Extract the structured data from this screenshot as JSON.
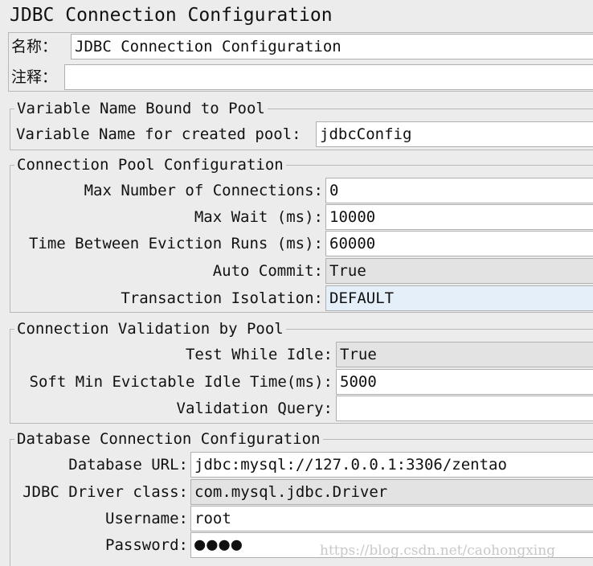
{
  "title": "JDBC Connection Configuration",
  "name_row": {
    "label": "名称：",
    "value": "JDBC Connection Configuration"
  },
  "comment_row": {
    "label": "注释：",
    "value": ""
  },
  "variable_group": {
    "legend": "Variable Name Bound to Pool",
    "label": "Variable Name for created pool:",
    "value": "jdbcConfig"
  },
  "pool_group": {
    "legend": "Connection Pool Configuration",
    "max_connections": {
      "label": "Max Number of Connections:",
      "value": "0"
    },
    "max_wait": {
      "label": "Max Wait (ms):",
      "value": "10000"
    },
    "eviction": {
      "label": "Time Between Eviction Runs (ms):",
      "value": "60000"
    },
    "auto_commit": {
      "label": "Auto Commit:",
      "value": "True"
    },
    "isolation": {
      "label": "Transaction Isolation:",
      "value": "DEFAULT"
    }
  },
  "validation_group": {
    "legend": "Connection Validation by Pool",
    "test_idle": {
      "label": "Test While Idle:",
      "value": "True"
    },
    "soft_min": {
      "label": "Soft Min Evictable Idle Time(ms):",
      "value": "5000"
    },
    "query": {
      "label": "Validation Query:",
      "value": ""
    }
  },
  "db_group": {
    "legend": "Database Connection Configuration",
    "url": {
      "label": "Database URL:",
      "value": "jdbc:mysql://127.0.0.1:3306/zentao"
    },
    "driver": {
      "label": "JDBC Driver class:",
      "value": "com.mysql.jdbc.Driver"
    },
    "username": {
      "label": "Username:",
      "value": "root"
    },
    "password": {
      "label": "Password:",
      "value": "●●●●"
    }
  },
  "watermark": "https://blog.csdn.net/caohongxing",
  "colors": {
    "background": "#ececec",
    "field": "#ffffff",
    "combo": "#e3e3e3",
    "selected": "#e4eff9",
    "border": "#b0b0b0"
  }
}
